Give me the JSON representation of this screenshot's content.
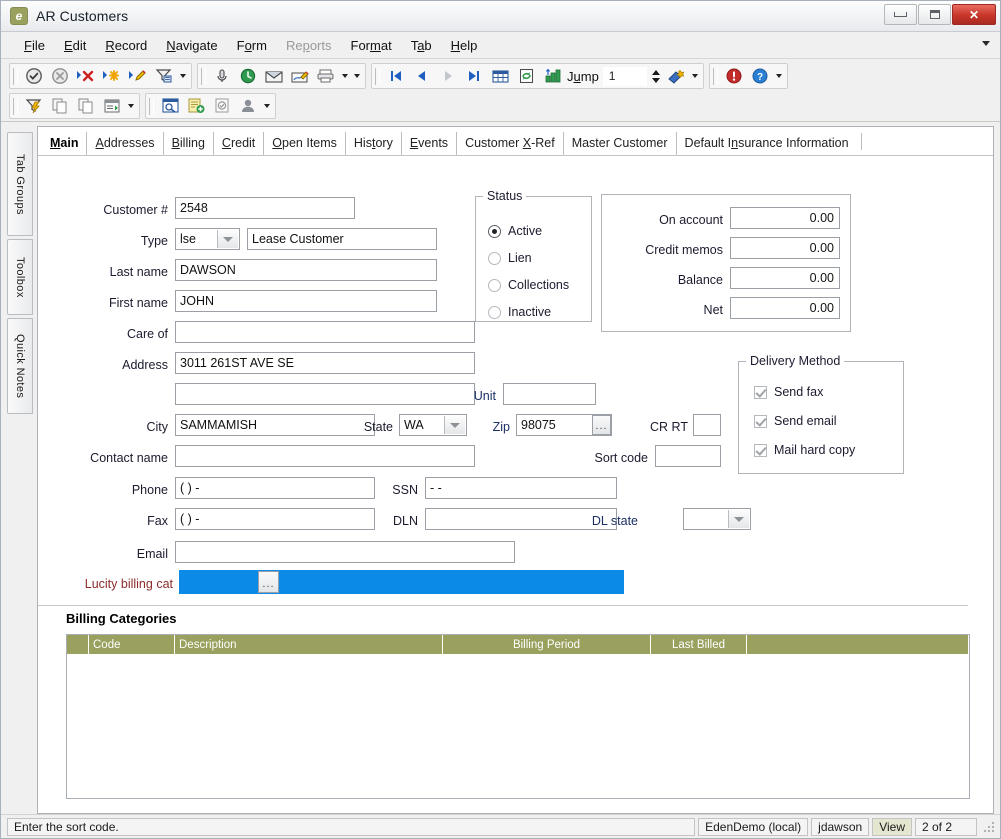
{
  "window": {
    "title": "AR Customers",
    "icon": "e",
    "buttons": {
      "minimize": "minimize-icon",
      "maximize": "maximize-icon",
      "close": "✕"
    }
  },
  "menu": {
    "items": [
      {
        "label": "File",
        "accel": "F",
        "disabled": false
      },
      {
        "label": "Edit",
        "accel": "E",
        "disabled": false
      },
      {
        "label": "Record",
        "accel": "R",
        "disabled": false
      },
      {
        "label": "Navigate",
        "accel": "N",
        "disabled": false
      },
      {
        "label": "Form",
        "accel": "o",
        "disabled": false
      },
      {
        "label": "Reports",
        "accel": "p",
        "disabled": true
      },
      {
        "label": "Format",
        "accel": "m",
        "disabled": false
      },
      {
        "label": "Tab",
        "accel": "a",
        "disabled": false
      },
      {
        "label": "Help",
        "accel": "H",
        "disabled": false
      }
    ]
  },
  "toolbar": {
    "row1": {
      "group1": [
        "accept-icon",
        "cancel-icon",
        "delete-record-icon",
        "new-record-icon",
        "edit-record-icon",
        "filter-icon"
      ],
      "group2": [
        "attach-icon",
        "schedule-icon",
        "email-icon",
        "signature-icon",
        "print-icon"
      ]
    },
    "row2": {
      "group1": [
        "quick-filter-icon",
        "copy-icon",
        "paste-icon",
        "report-icon"
      ],
      "group2": [
        "view-detail-icon",
        "add-note-icon",
        "validate-icon",
        "user-icon"
      ]
    },
    "nav": {
      "icons": [
        "first-record-icon",
        "previous-record-icon",
        "next-record-icon",
        "last-record-icon",
        "grid-view-icon",
        "refresh-icon",
        "sort-icon"
      ],
      "jump_label": "Jump",
      "jump_value": "1"
    },
    "help": [
      "alert-icon",
      "help-icon"
    ]
  },
  "vertical_tabs": [
    "Tab Groups",
    "Toolbox",
    "Quick Notes"
  ],
  "tabs": [
    {
      "label": "Main",
      "accel": "M",
      "active": true
    },
    {
      "label": "Addresses",
      "accel": "A",
      "active": false
    },
    {
      "label": "Billing",
      "accel": "B",
      "active": false
    },
    {
      "label": "Credit",
      "accel": "C",
      "active": false
    },
    {
      "label": "Open Items",
      "accel": "O",
      "active": false
    },
    {
      "label": "History",
      "accel": "t",
      "active": false
    },
    {
      "label": "Events",
      "accel": "E",
      "active": false
    },
    {
      "label": "Customer X-Ref",
      "accel": "X",
      "active": false
    },
    {
      "label": "Master Customer",
      "accel": "",
      "active": false
    },
    {
      "label": "Default Insurance Information",
      "accel": "n",
      "active": false
    }
  ],
  "form": {
    "customer_number": {
      "label": "Customer #",
      "value": "2548"
    },
    "type": {
      "label": "Type",
      "code": "lse",
      "description": "Lease Customer"
    },
    "last_name": {
      "label": "Last name",
      "value": "DAWSON"
    },
    "first_name": {
      "label": "First name",
      "value": "JOHN"
    },
    "care_of": {
      "label": "Care of",
      "value": ""
    },
    "address1": {
      "label": "Address",
      "value": "3011 261ST AVE SE"
    },
    "address2": {
      "label": "",
      "value": ""
    },
    "unit": {
      "label": "Unit",
      "value": ""
    },
    "city": {
      "label": "City",
      "value": "SAMMAMISH"
    },
    "state": {
      "label": "State",
      "value": "WA"
    },
    "zip": {
      "label": "Zip",
      "value": "98075",
      "browse": "..."
    },
    "cr_rt": {
      "label": "CR RT",
      "value": ""
    },
    "contact_name": {
      "label": "Contact name",
      "value": ""
    },
    "sort_code": {
      "label": "Sort code",
      "value": ""
    },
    "phone": {
      "label": "Phone",
      "value": "(   )    -"
    },
    "ssn": {
      "label": "SSN",
      "value": "  -  -"
    },
    "fax": {
      "label": "Fax",
      "value": "(   )    -"
    },
    "dln": {
      "label": "DLN",
      "value": ""
    },
    "dl_state": {
      "label": "DL state",
      "value": ""
    },
    "email": {
      "label": "Email",
      "value": ""
    },
    "lucity_billing_cat": {
      "label": "Lucity billing cat",
      "value": "",
      "browse": "..."
    }
  },
  "status_group": {
    "caption": "Status",
    "options": [
      {
        "label": "Active",
        "selected": true
      },
      {
        "label": "Lien",
        "selected": false
      },
      {
        "label": "Collections",
        "selected": false
      },
      {
        "label": "Inactive",
        "selected": false
      }
    ]
  },
  "balances": [
    {
      "label": "On account",
      "value": "0.00"
    },
    {
      "label": "Credit memos",
      "value": "0.00"
    },
    {
      "label": "Balance",
      "value": "0.00"
    },
    {
      "label": "Net",
      "value": "0.00"
    }
  ],
  "delivery_method": {
    "caption": "Delivery Method",
    "options": [
      {
        "label": "Send fax",
        "checked": true
      },
      {
        "label": "Send email",
        "checked": true
      },
      {
        "label": "Mail hard copy",
        "checked": true
      }
    ]
  },
  "billing_categories": {
    "title": "Billing Categories",
    "columns": [
      "",
      "Code",
      "Description",
      "Billing Period",
      "Last Billed",
      ""
    ],
    "rows": []
  },
  "statusbar": {
    "message": "Enter the sort code.",
    "database": "EdenDemo (local)",
    "user": "jdawson",
    "mode": "View",
    "record_position": "2 of 2"
  },
  "colors": {
    "accent_selection": "#0b8ae8",
    "grid_header": "#9aa05e",
    "title_icon": "#9aa05e",
    "close_button": "#c8352a",
    "label_blue": "#1b2f66",
    "label_red": "#8d2b2b",
    "status_olive": "#e4e6cf"
  }
}
